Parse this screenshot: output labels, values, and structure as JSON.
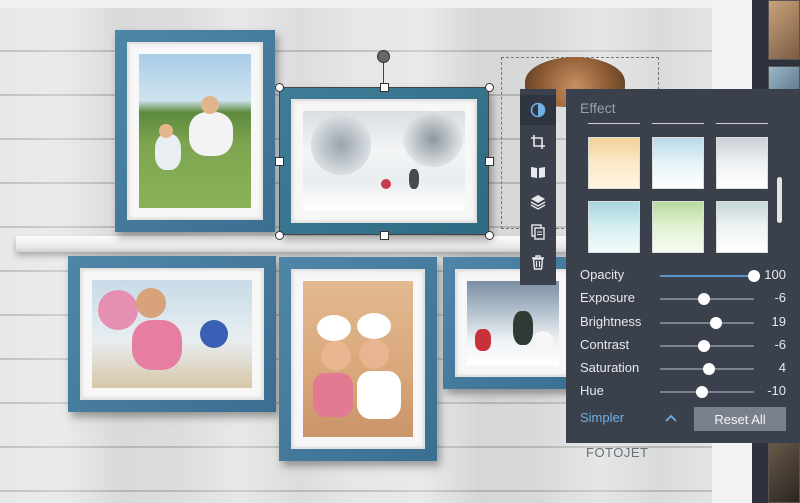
{
  "panel": {
    "title": "Effect",
    "sliders": [
      {
        "label": "Opacity",
        "value": "100",
        "level": 1.0
      },
      {
        "label": "Exposure",
        "value": "-6",
        "level": 0.47
      },
      {
        "label": "Brightness",
        "value": "19",
        "level": 0.6
      },
      {
        "label": "Contrast",
        "value": "-6",
        "level": 0.47
      },
      {
        "label": "Saturation",
        "value": "4",
        "level": 0.52
      },
      {
        "label": "Hue",
        "value": "-10",
        "level": 0.45
      }
    ],
    "simpler_label": "Simpler",
    "reset_label": "Reset All"
  },
  "tools": [
    {
      "name": "effect-icon"
    },
    {
      "name": "crop-icon"
    },
    {
      "name": "flip-book-icon"
    },
    {
      "name": "layers-icon"
    },
    {
      "name": "duplicate-icon"
    },
    {
      "name": "trash-icon"
    }
  ],
  "brand": "FOTOJET",
  "colors": {
    "panel_bg": "#3b414c",
    "accent": "#6fb0e6",
    "frame": "#4a7fa2"
  }
}
